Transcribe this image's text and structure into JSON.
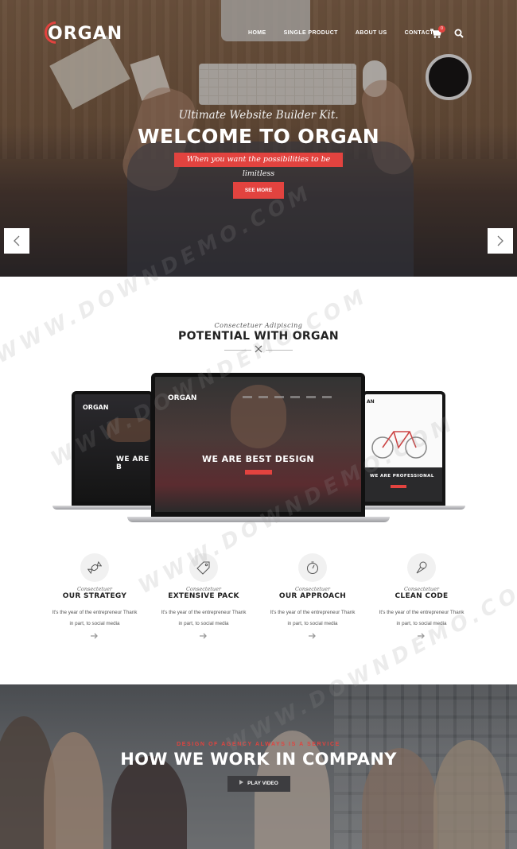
{
  "brand": {
    "logo_text": "ORGAN",
    "accent": "#e2433f"
  },
  "nav": {
    "items": [
      {
        "label": "HOME"
      },
      {
        "label": "SINGLE PRODUCT"
      },
      {
        "label": "ABOUT US"
      },
      {
        "label": "CONTACT"
      }
    ],
    "cart_count": "0",
    "cart_icon": "shopping-cart-icon",
    "search_icon": "search-icon"
  },
  "hero": {
    "subtitle": "Ultimate Website Builder Kit.",
    "title": "WELCOME TO ORGAN",
    "tagline": "When you want the possibilities to be limitless",
    "button": "SEE MORE",
    "prev_icon": "chevron-left-icon",
    "next_icon": "chevron-right-icon"
  },
  "potential": {
    "kicker": "Consectetuer Adipiscing",
    "title": "POTENTIAL WITH ORGAN",
    "divider_icon": "close-icon",
    "mockups": {
      "left_logo": "ORGAN",
      "left_heading": "WE ARE B",
      "main_logo": "ORGAN",
      "main_heading": "WE ARE BEST DESIGN",
      "right_logo": "AN",
      "right_heading": "WE ARE PROFESSIONAL"
    }
  },
  "features": [
    {
      "icon": "candy-icon",
      "kicker": "Consectetuer",
      "title": "OUR STRATEGY",
      "text_1": "It's the year of the entrepreneur Thank",
      "text_2": "in part, to social media",
      "arrow_icon": "arrow-right-icon"
    },
    {
      "icon": "tag-icon",
      "kicker": "Consectetuer",
      "title": "EXTENSIVE PACK",
      "text_1": "It's the year of the entrepreneur Thank",
      "text_2": "in part, to social media",
      "arrow_icon": "arrow-right-icon"
    },
    {
      "icon": "timer-icon",
      "kicker": "Consectetuer",
      "title": "OUR APPROACH",
      "text_1": "It's the year of the entrepreneur Thank",
      "text_2": "in part, to social media",
      "arrow_icon": "arrow-right-icon"
    },
    {
      "icon": "ice-cream-icon",
      "kicker": "Consectetuer",
      "title": "CLEAN CODE",
      "text_1": "It's the year of the entrepreneur Thank",
      "text_2": "in part, to social media",
      "arrow_icon": "arrow-right-icon"
    }
  ],
  "work": {
    "kicker": "DESIGN OF AGENCY ALWAYS IS A SERVICE",
    "title": "HOW WE WORK IN COMPANY",
    "button": "PLAY VIDEO",
    "button_icon": "play-icon"
  },
  "watermark": "WWW.DOWNDEMO.COM"
}
